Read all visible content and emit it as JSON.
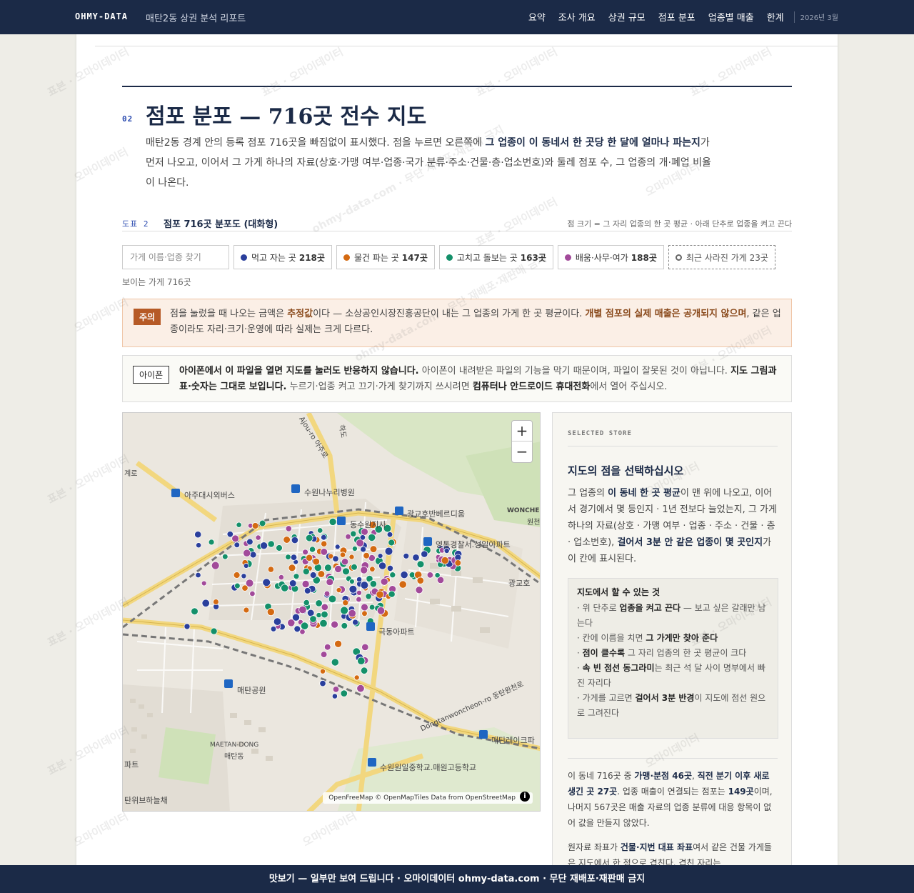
{
  "header": {
    "brand": "OHMY-DATA",
    "subtitle": "매탄2동 상권 분석 리포트",
    "nav": [
      "요약",
      "조사 개요",
      "상권 규모",
      "점포 분포",
      "업종별 매출",
      "한계"
    ],
    "date": "2026년 3월"
  },
  "section": {
    "number": "02",
    "title": "점포 분포 — 716곳 전수 지도",
    "intro_a": "매탄2동 경계 안의 등록 점포 716곳을 빠짐없이 표시했다. 점을 누르면 오른쪽에 ",
    "intro_b": "그 업종이 이 동네서 한 곳당 한 달에 얼마나 파는지",
    "intro_c": "가 먼저 나오고, 이어서 그 가게 하나의 자료(상호·가맹 여부·업종·국가 분류·주소·건물·층·업소번호)와 둘레 점포 수, 그 업종의 개·폐업 비율이 나온다."
  },
  "figure": {
    "label": "도표 2",
    "title": "점포 716곳 분포도 (대화형)",
    "note": "점 크기 = 그 자리 업종의 한 곳 평균 · 아래 단추로 업종을 켜고 끈다"
  },
  "filters": {
    "search_placeholder": "가게 이름·업종 찾기",
    "chips": [
      {
        "label": "먹고 자는 곳",
        "count": "218곳",
        "color": "#2a3f9c"
      },
      {
        "label": "물건 파는 곳",
        "count": "147곳",
        "color": "#d46a12"
      },
      {
        "label": "고치고 돌보는 곳",
        "count": "163곳",
        "color": "#14906a"
      },
      {
        "label": "배움·사무·여가",
        "count": "188곳",
        "color": "#a24a9a"
      }
    ],
    "closed_label": "최근 사라진 가게 23곳",
    "visible_count": "보이는 가게 716곳"
  },
  "warning": {
    "tag": "주의",
    "text_a": "점을 눌렀을 때 나오는 금액은 ",
    "text_b": "추정값",
    "text_c": "이다 — 소상공인시장진흥공단이 내는 그 업종의 가게 한 곳 평균이다. ",
    "text_d": "개별 점포의 실제 매출은 공개되지 않으며",
    "text_e": ", 같은 업종이라도 자리·크기·운영에 따라 실제는 크게 다르다."
  },
  "iphone": {
    "tag": "아이폰",
    "text_a": "아이폰에서 이 파일을 열면 지도를 눌러도 반응하지 않습니다.",
    "text_b": " 아이폰이 내려받은 파일의 기능을 막기 때문이며, 파일이 잘못된 것이 아닙니다. ",
    "text_c": "지도 그림과 표·숫자는 그대로 보입니다.",
    "text_d": " 누르기·업종 켜고 끄기·가게 찾기까지 쓰시려면 ",
    "text_e": "컴퓨터나 안드로이드 휴대전화",
    "text_f": "에서 열어 주십시오."
  },
  "map": {
    "zoom_in": "+",
    "zoom_out": "−",
    "attribution": "OpenFreeMap © OpenMapTiles Data from OpenStreetMap",
    "info": "i",
    "labels": {
      "l1": "아주대시외버스",
      "l2": "수원나누리병원",
      "l3": "광교호반베르디움",
      "l4": "동수원지사",
      "l5": "영통경찰서.성일아파트",
      "l6": "광교호",
      "l7": "극동아파트",
      "l8": "매탄공원",
      "l9": "MAETAN-DONG",
      "l10": "매탄동",
      "l11": "매탄레이크파",
      "l12": "수원원일중학교.매원고등학교",
      "l13": "파트",
      "l14": "탄위브하늘채",
      "l15": "WONCHE",
      "l16": "원천",
      "l17": "Dongtanwoncheon-ro 동탄원천로",
      "l18": "Ajou-ro 아주로",
      "l19": "하도",
      "l20": "계로"
    }
  },
  "panel": {
    "kicker": "SELECTED STORE",
    "title": "지도의 점을 선택하십시오",
    "desc_a": "그 업종의 ",
    "desc_b": "이 동네 한 곳 평균",
    "desc_c": "이 맨 위에 나오고, 이어서 경기에서 몇 등인지 · 1년 전보다 늘었는지, 그 가게 하나의 자료(상호 · 가맹 여부 · 업종 · 주소 · 건물 · 층 · 업소번호), ",
    "desc_d": "걸어서 3분 안 같은 업종이 몇 곳인지",
    "desc_e": "가 이 칸에 표시된다.",
    "howto_title": "지도에서 할 수 있는 것",
    "howto_1a": "· 위 단추로 ",
    "howto_1b": "업종을 켜고 끈다",
    "howto_1c": " — 보고 싶은 갈래만 남는다",
    "howto_2a": "· 칸에 이름을 치면 ",
    "howto_2b": "그 가게만 찾아 준다",
    "howto_3a": "· ",
    "howto_3b": "점이 클수록",
    "howto_3c": " 그 자리 업종의 한 곳 평균이 크다",
    "howto_4a": "· ",
    "howto_4b": "속 빈 점선 동그라미",
    "howto_4c": "는 최근 석 달 사이 명부에서 빠진 자리다",
    "howto_5a": "· 가게를 고르면 ",
    "howto_5b": "걸어서 3분 반경",
    "howto_5c": "이 지도에 점선 원으로 그려진다",
    "stats_a": "이 동네 716곳 중 ",
    "stats_b": "가맹·분점 46곳",
    "stats_c": ", ",
    "stats_d": "직전 분기 이후 새로 생긴 곳 27곳",
    "stats_e": ". 업종 매출이 연결되는 점포는 ",
    "stats_f": "149곳",
    "stats_g": "이며, 나머지 567곳은 매출 자료의 업종 분류에 대응 항목이 없어 값을 만들지 않았다.",
    "coord_a": "원자료 좌표가 ",
    "coord_b": "건물·지번 대표 좌표",
    "coord_c": "여서 같은 건물 가게들은 지도에서 한 점으로 겹친다. 겹친 자리는"
  },
  "footer": {
    "text": "맛보기 — 일부만 보여 드립니다 · 오마이데이터 ohmy-data.com · 무단 재배포·재판매 금지"
  },
  "watermark": {
    "a": "표본 · 오마이데이터",
    "b": "ohmy-data.com · 무단 재배포·재판매 금지",
    "c": "오마이데이터"
  }
}
